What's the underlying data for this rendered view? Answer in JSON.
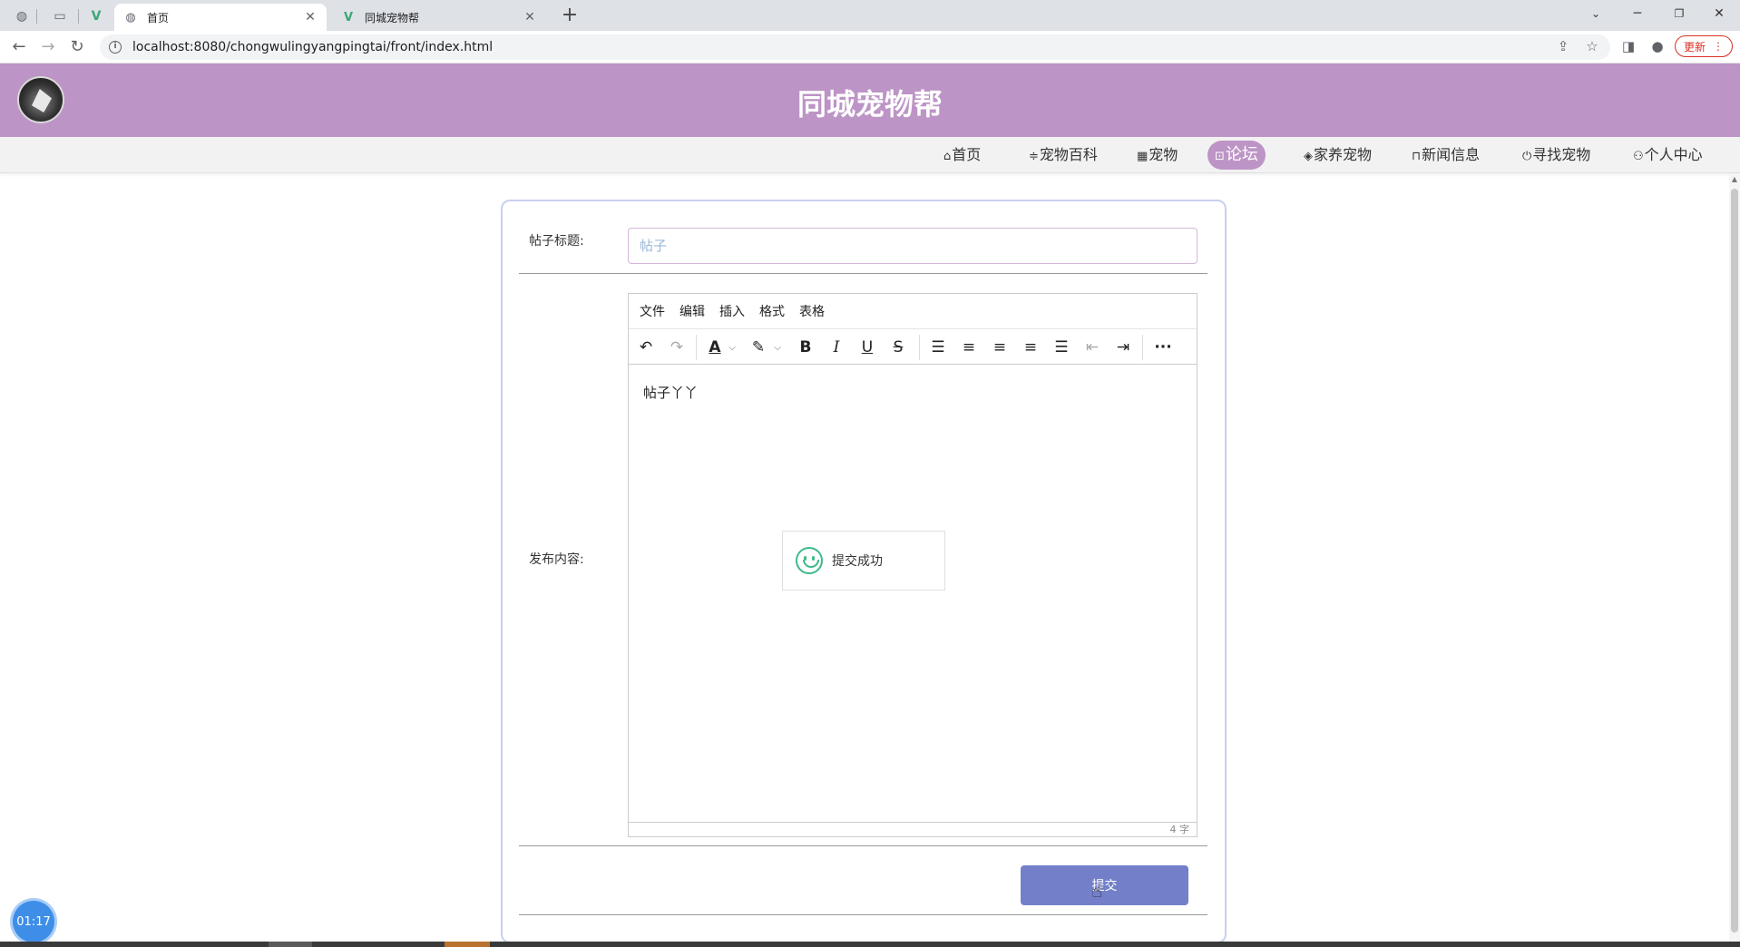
{
  "browser": {
    "tabs": [
      {
        "title": "首页",
        "icon": "globe-icon",
        "active": true
      },
      {
        "title": "同城宠物帮",
        "icon": "vue-logo-icon",
        "active": false
      }
    ],
    "url": "localhost:8080/chongwulingyangpingtai/front/index.html",
    "update_label": "更新",
    "new_tab_glyph": "+",
    "window_controls": [
      "minimize",
      "restore",
      "close"
    ]
  },
  "site": {
    "title": "同城宠物帮",
    "nav": [
      {
        "label": "首页",
        "icon": "home-icon",
        "active": false
      },
      {
        "label": "宠物百科",
        "icon": "sliders-icon",
        "active": false
      },
      {
        "label": "宠物",
        "icon": "grid-icon",
        "active": false
      },
      {
        "label": "论坛",
        "icon": "forum-icon",
        "active": true
      },
      {
        "label": "家养宠物",
        "icon": "layers-icon",
        "active": false
      },
      {
        "label": "新闻信息",
        "icon": "book-icon",
        "active": false
      },
      {
        "label": "寻找宠物",
        "icon": "power-icon",
        "active": false
      },
      {
        "label": "个人中心",
        "icon": "user-icon",
        "active": false
      }
    ]
  },
  "form": {
    "title_label": "帖子标题:",
    "title_placeholder": "帖子",
    "content_label": "发布内容:",
    "editor": {
      "menus": [
        "文件",
        "编辑",
        "插入",
        "格式",
        "表格"
      ],
      "content": "帖子丫丫",
      "word_count": "4 字"
    },
    "submit_label": "提交"
  },
  "toast": {
    "text": "提交成功",
    "icon": "smile-icon",
    "color": "#3dbb8a"
  },
  "timer": "01:17",
  "colors": {
    "header": "#bd94c6",
    "submit": "#7380c9",
    "active_nav": "#bd94c6"
  }
}
